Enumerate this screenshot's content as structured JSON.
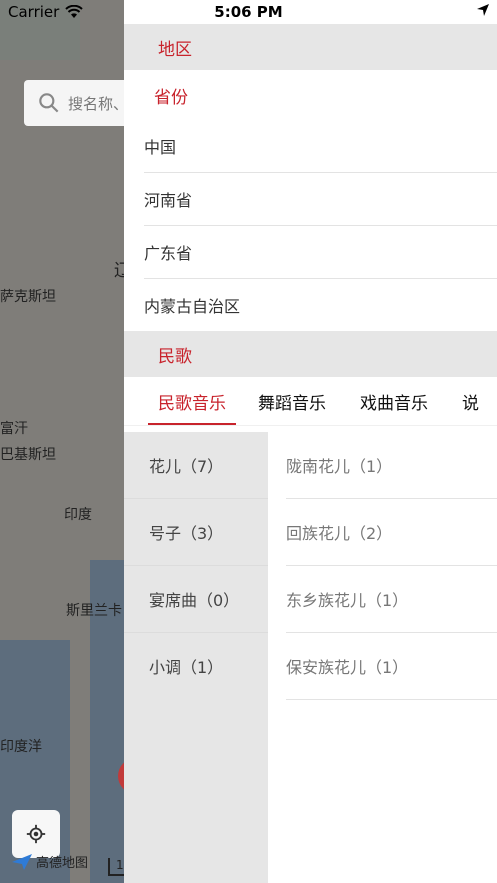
{
  "status_bar": {
    "carrier": "Carrier",
    "time": "5:06 PM"
  },
  "map": {
    "search_placeholder": "搜名称、",
    "labels": {
      "kazakhstan": "萨克斯坦",
      "afghanistan": "富汗",
      "pakistan": "巴基斯坦",
      "india": "印度",
      "sri_lanka": "斯里兰卡",
      "indian_ocean": "印度洋",
      "partial_edge": "辽"
    },
    "logo_text": "高德地图",
    "scale_text": "1"
  },
  "drawer": {
    "region_header": "地区",
    "province_label": "省份",
    "regions": [
      "中国",
      "河南省",
      "广东省",
      "内蒙古自治区"
    ],
    "folk_header": "民歌",
    "tabs": [
      "民歌音乐",
      "舞蹈音乐",
      "戏曲音乐",
      "说"
    ],
    "active_tab_index": 0,
    "categories": [
      "花儿（7）",
      "号子（3）",
      "宴席曲（0）",
      "小调（1）"
    ],
    "subcategories": [
      "陇南花儿（1）",
      "回族花儿（2）",
      "东乡族花儿（1）",
      "保安族花儿（1）"
    ]
  },
  "colors": {
    "accent": "#c8232c",
    "header_bg": "#e6e6e6"
  }
}
